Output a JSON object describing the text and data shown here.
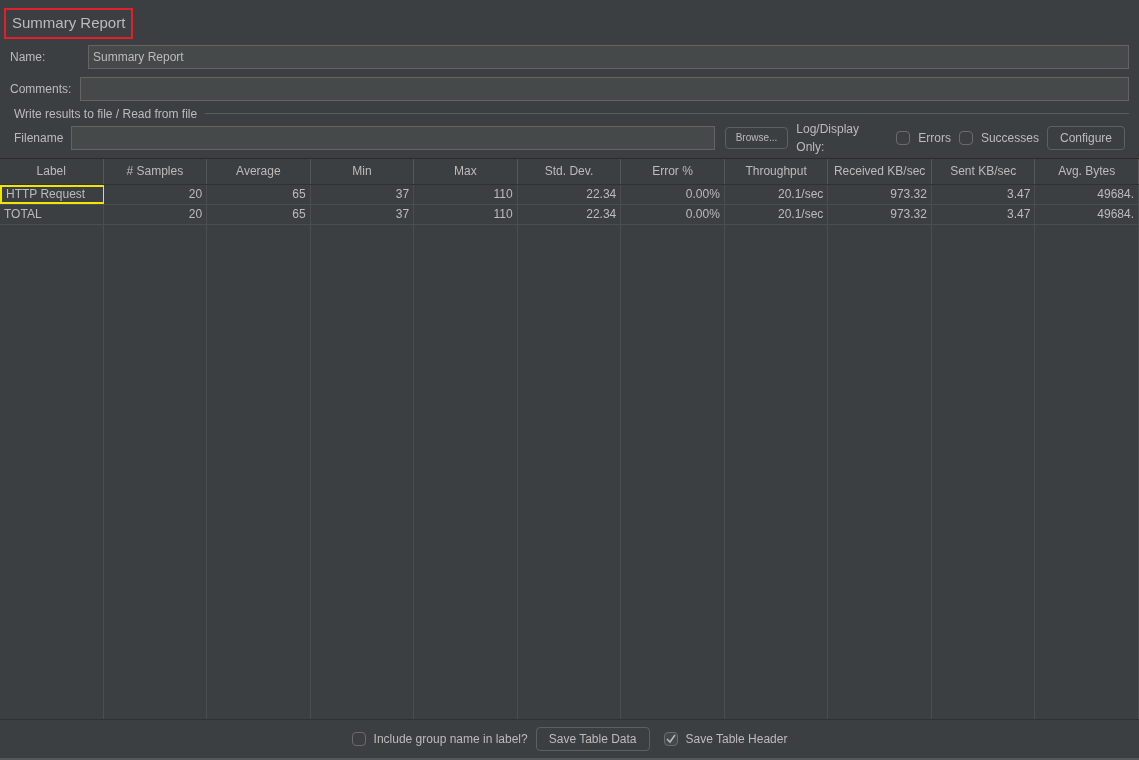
{
  "title": {
    "text": "Summary Report",
    "annotated": true
  },
  "name_field": {
    "label": "Name:",
    "value": "Summary Report"
  },
  "comments_field": {
    "label": "Comments:"
  },
  "file_section": {
    "legend": "Write results to file / Read from file",
    "filename_label": "Filename",
    "browse": "Browse...",
    "log_label": "Log/Display Only:",
    "options": [
      {
        "label": "Errors",
        "checked": false
      },
      {
        "label": "Successes",
        "checked": false
      }
    ],
    "configure": "Configure"
  },
  "table": {
    "columns": [
      "Label",
      "# Samples",
      "Average",
      "Min",
      "Max",
      "Std. Dev.",
      "Error %",
      "Throughput",
      "Received KB/sec",
      "Sent KB/sec",
      "Avg. Bytes"
    ],
    "rows": [
      {
        "annotated": true,
        "cells": [
          "HTTP Request",
          "20",
          "65",
          "37",
          "110",
          "22.34",
          "0.00%",
          "20.1/sec",
          "973.32",
          "3.47",
          "49684."
        ]
      },
      {
        "annotated": false,
        "cells": [
          "TOTAL",
          "20",
          "65",
          "37",
          "110",
          "22.34",
          "0.00%",
          "20.1/sec",
          "973.32",
          "3.47",
          "49684."
        ]
      }
    ]
  },
  "footer": {
    "include_group": {
      "label": "Include group name in label?",
      "checked": false
    },
    "save_data": "Save Table Data",
    "save_header": {
      "label": "Save Table Header",
      "checked": true
    }
  }
}
